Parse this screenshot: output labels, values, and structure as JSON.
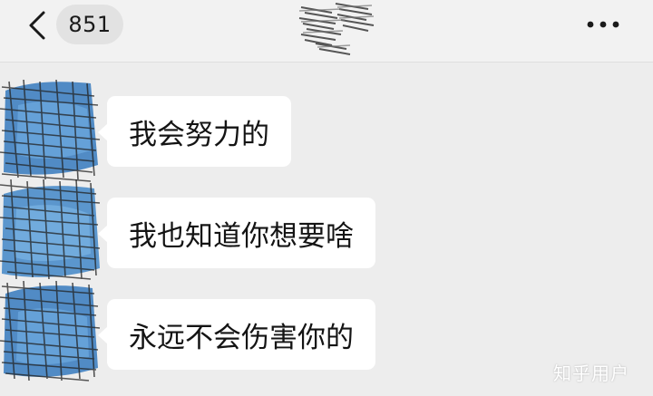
{
  "header": {
    "back_icon": "chevron-left-icon",
    "unread_count": "851",
    "title_obscured": true,
    "more_icon": "more-horizontal-icon"
  },
  "messages": [
    {
      "text": "我会努力的",
      "avatar_obscured": true
    },
    {
      "text": "我也知道你想要啥",
      "avatar_obscured": true
    },
    {
      "text": "永远不会伤害你的",
      "avatar_obscured": true
    }
  ],
  "watermark": "知乎用户",
  "colors": {
    "background": "#ededed",
    "bubble": "#ffffff",
    "avatar_blue": "#3f7fc0",
    "scribble": "#2a2a2a"
  }
}
